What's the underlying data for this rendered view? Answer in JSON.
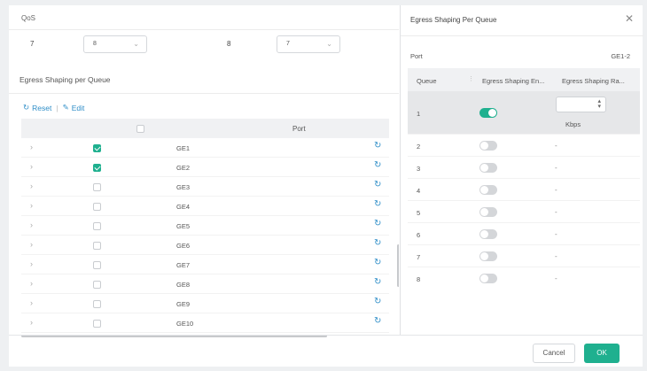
{
  "qos": {
    "title": "QoS",
    "row": [
      {
        "num": "7",
        "select": "8"
      },
      {
        "num": "8",
        "select": "7"
      }
    ]
  },
  "section": {
    "label": "Egress Shaping per Queue",
    "reset": "Reset",
    "edit": "Edit",
    "port_header": "Port"
  },
  "ports": [
    {
      "name": "GE1",
      "checked": true
    },
    {
      "name": "GE2",
      "checked": true
    },
    {
      "name": "GE3",
      "checked": false
    },
    {
      "name": "GE4",
      "checked": false
    },
    {
      "name": "GE5",
      "checked": false
    },
    {
      "name": "GE6",
      "checked": false
    },
    {
      "name": "GE7",
      "checked": false
    },
    {
      "name": "GE8",
      "checked": false
    },
    {
      "name": "GE9",
      "checked": false
    },
    {
      "name": "GE10",
      "checked": false
    }
  ],
  "drawer": {
    "title": "Egress Shaping Per Queue",
    "port_label": "Port",
    "port_value": "GE1-2",
    "headers": {
      "queue": "Queue",
      "enable": "Egress Shaping En...",
      "rate": "Egress Shaping Ra..."
    },
    "rate_unit": "Kbps",
    "queues": [
      {
        "q": "1",
        "enabled": true,
        "rate": ""
      },
      {
        "q": "2",
        "enabled": false,
        "rate": "-"
      },
      {
        "q": "3",
        "enabled": false,
        "rate": "-"
      },
      {
        "q": "4",
        "enabled": false,
        "rate": "-"
      },
      {
        "q": "5",
        "enabled": false,
        "rate": "-"
      },
      {
        "q": "6",
        "enabled": false,
        "rate": "-"
      },
      {
        "q": "7",
        "enabled": false,
        "rate": "-"
      },
      {
        "q": "8",
        "enabled": false,
        "rate": "-"
      }
    ]
  },
  "footer": {
    "cancel": "Cancel",
    "ok": "OK"
  },
  "colors": {
    "accent": "#1fb08f",
    "link": "#2f8ec8"
  }
}
